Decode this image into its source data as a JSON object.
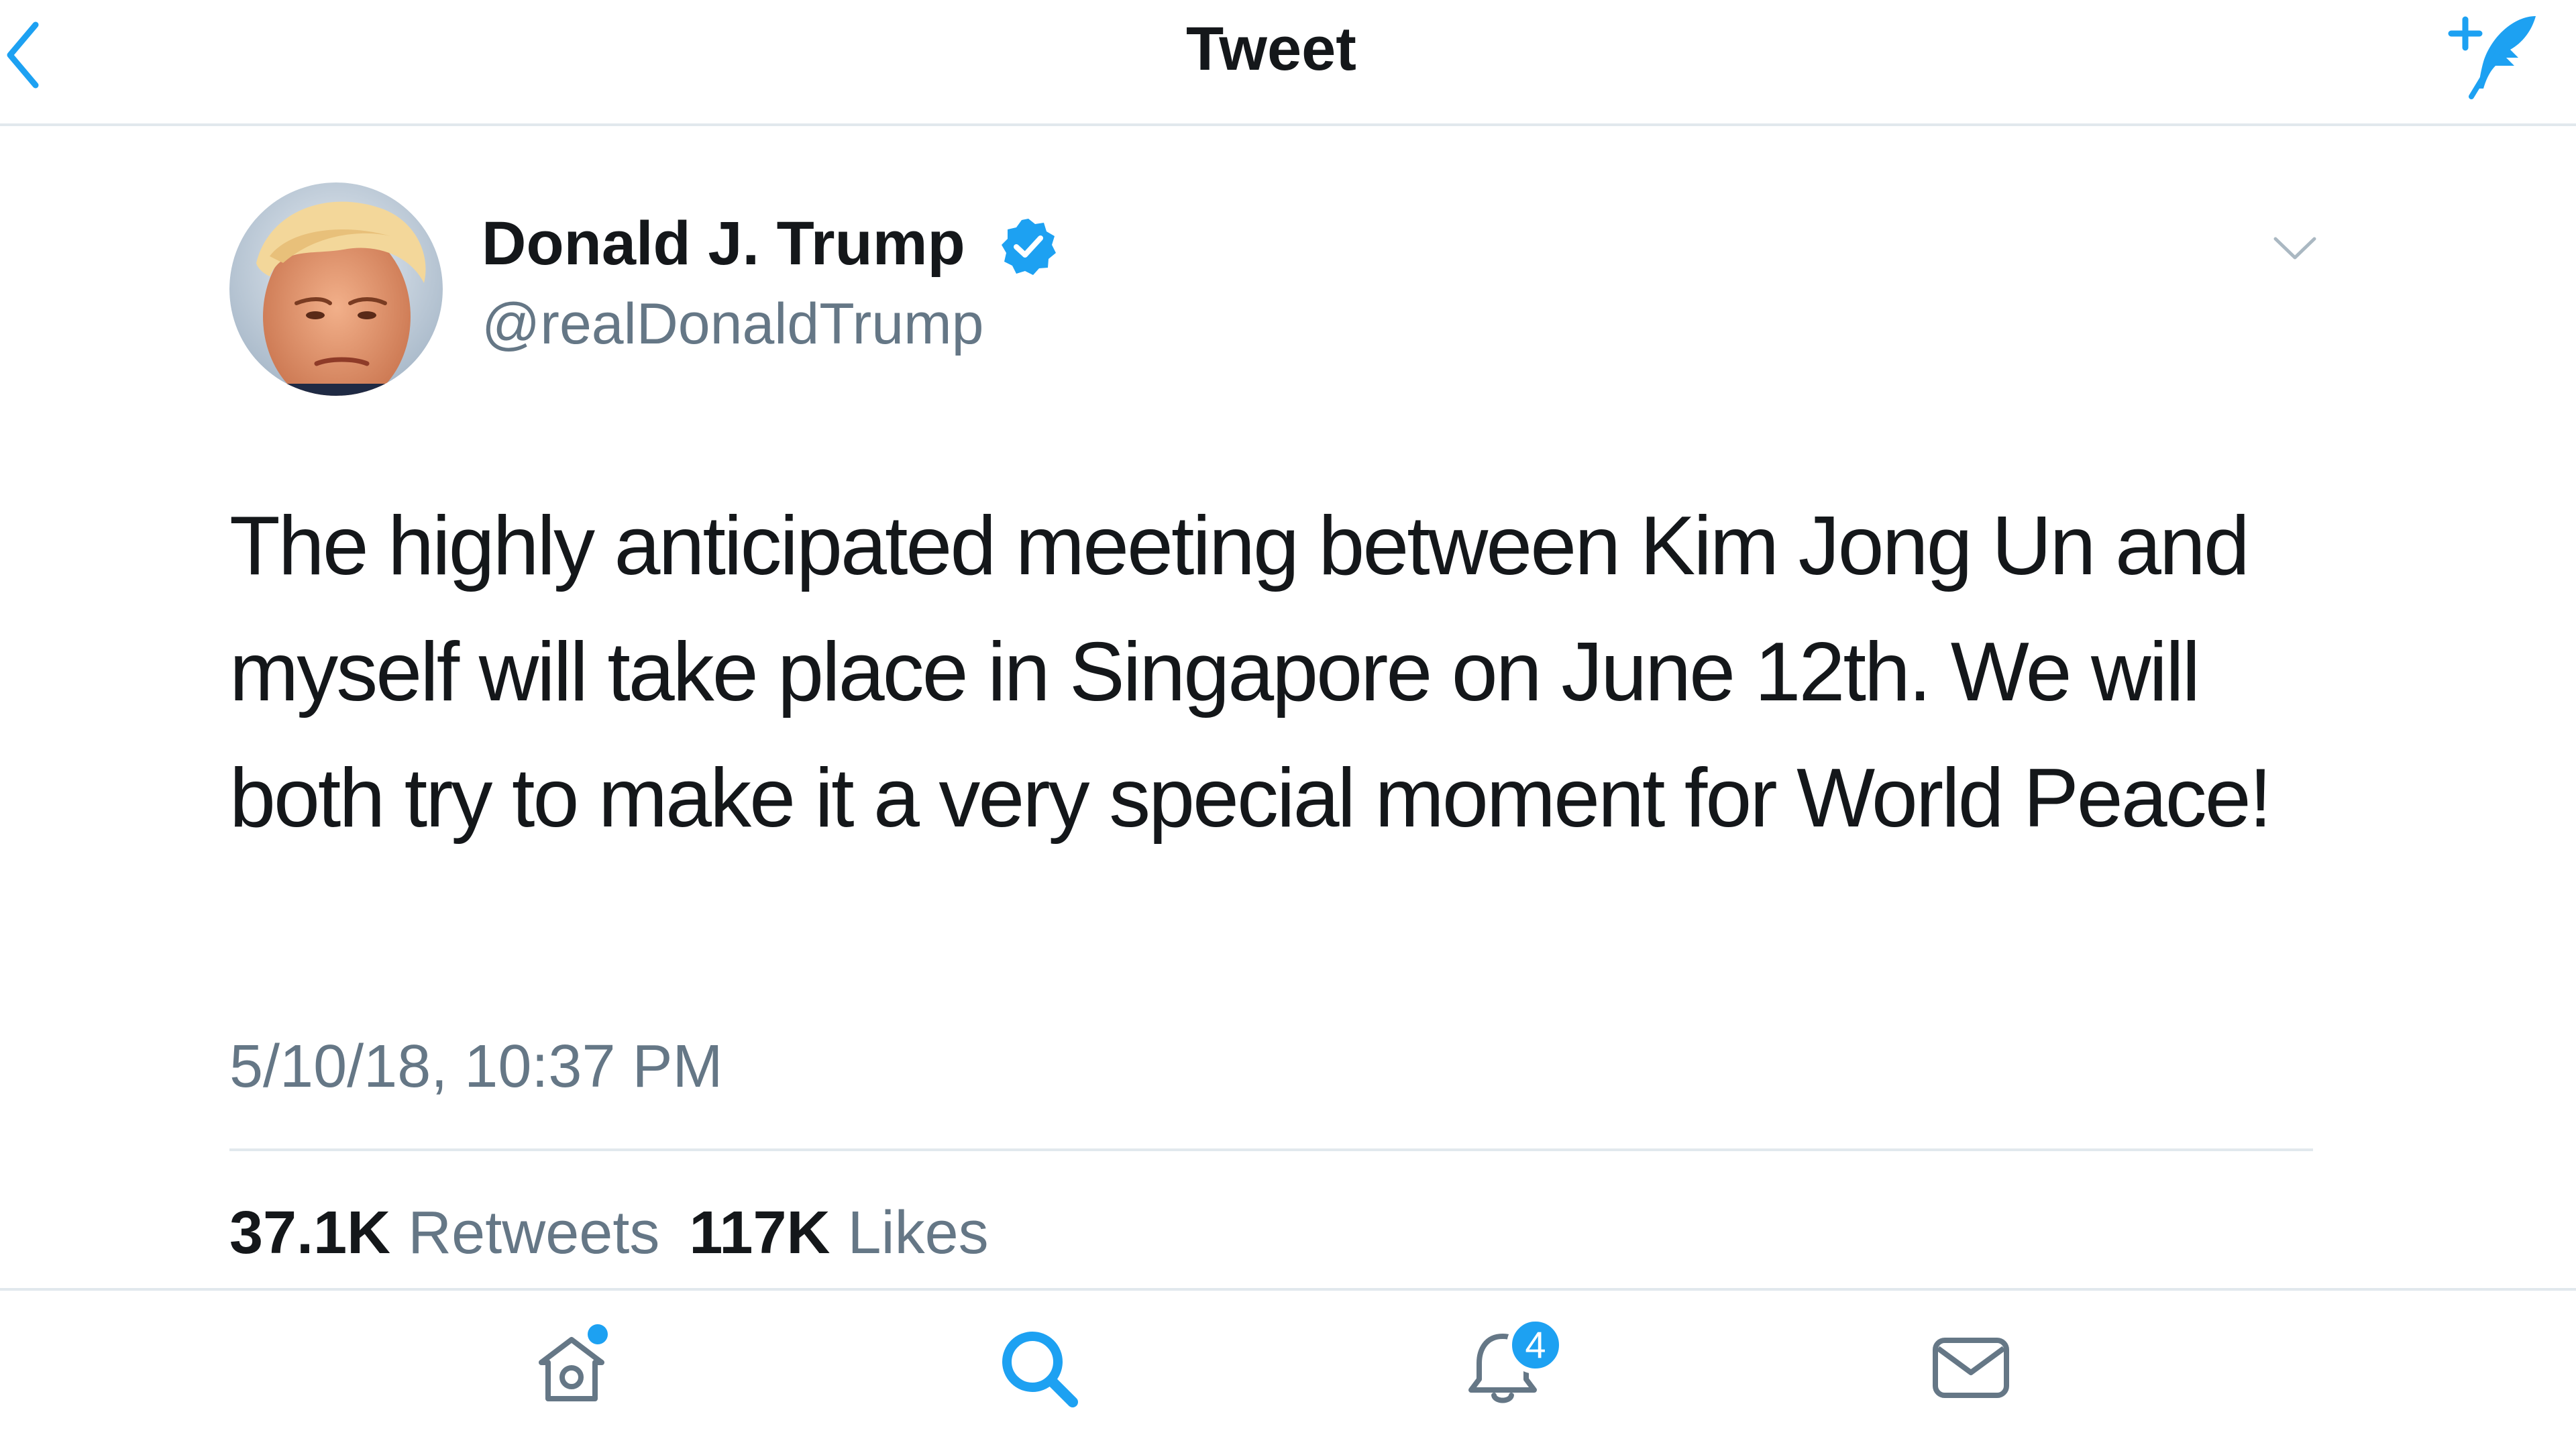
{
  "header": {
    "title": "Tweet",
    "back_icon": "chevron-left-icon",
    "compose_icon": "compose-tweet-icon"
  },
  "tweet": {
    "author_name": "Donald J. Trump",
    "author_handle": "@realDonaldTrump",
    "verified": true,
    "text": "The highly anticipated meeting between Kim Jong Un and myself will take place in Singapore on June 12th. We will both try to make it a very special moment for World Peace!",
    "timestamp": "5/10/18, 10:37 PM",
    "retweets_count": "37.1K",
    "retweets_label": "Retweets",
    "likes_count": "117K",
    "likes_label": "Likes"
  },
  "bottom_nav": {
    "items": [
      {
        "icon": "home-icon",
        "has_dot": true
      },
      {
        "icon": "search-icon",
        "active": true
      },
      {
        "icon": "notifications-icon",
        "badge": "4"
      },
      {
        "icon": "messages-icon"
      }
    ]
  },
  "colors": {
    "accent": "#1da1f2",
    "text_primary": "#14171a",
    "text_secondary": "#657786",
    "border": "#e1e8ed"
  }
}
